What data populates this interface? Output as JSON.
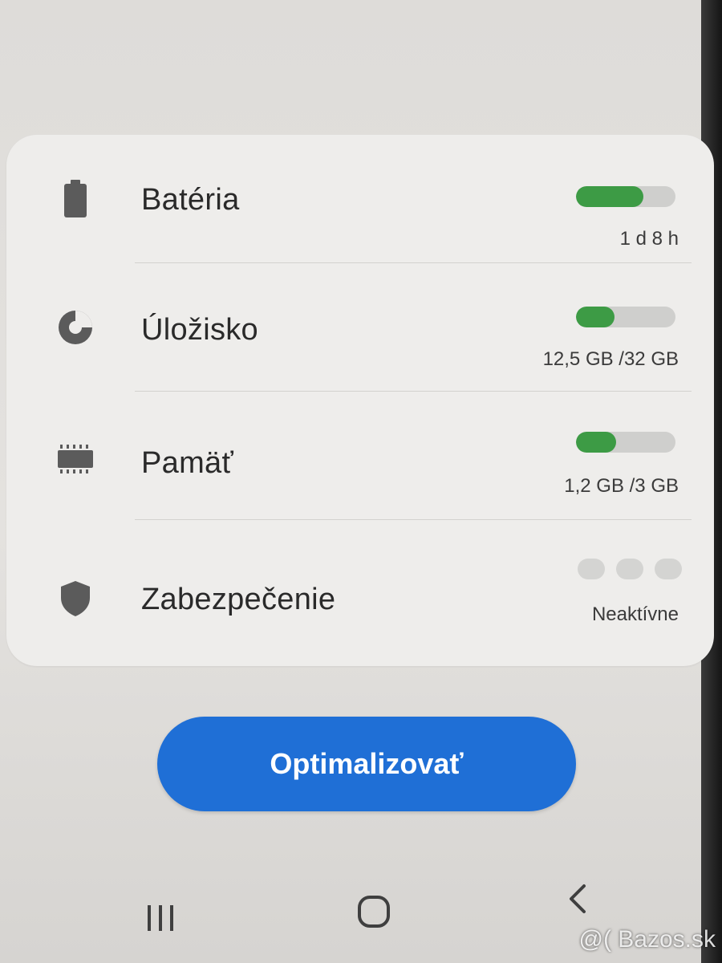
{
  "colors": {
    "accent_green": "#3d9b45",
    "button_blue": "#1f6fd6",
    "track_grey": "#cfcfcd"
  },
  "rows": [
    {
      "icon": "battery-icon",
      "label": "Batéria",
      "value": "1 d 8 h",
      "level": 0.68
    },
    {
      "icon": "storage-icon",
      "label": "Úložisko",
      "value": "12,5 GB /32 GB",
      "level": 0.39
    },
    {
      "icon": "memory-icon",
      "label": "Pamäť",
      "value": "1,2 GB /3 GB",
      "level": 0.4
    },
    {
      "icon": "shield-icon",
      "label": "Zabezpečenie",
      "value": "Neaktívne",
      "level": 0
    }
  ],
  "optimize_button": {
    "label": "Optimalizovať"
  },
  "navbar": {
    "recents": "recent-apps-icon",
    "home": "home-icon",
    "back": "back-icon"
  },
  "watermark": "@( Bazos.sk"
}
